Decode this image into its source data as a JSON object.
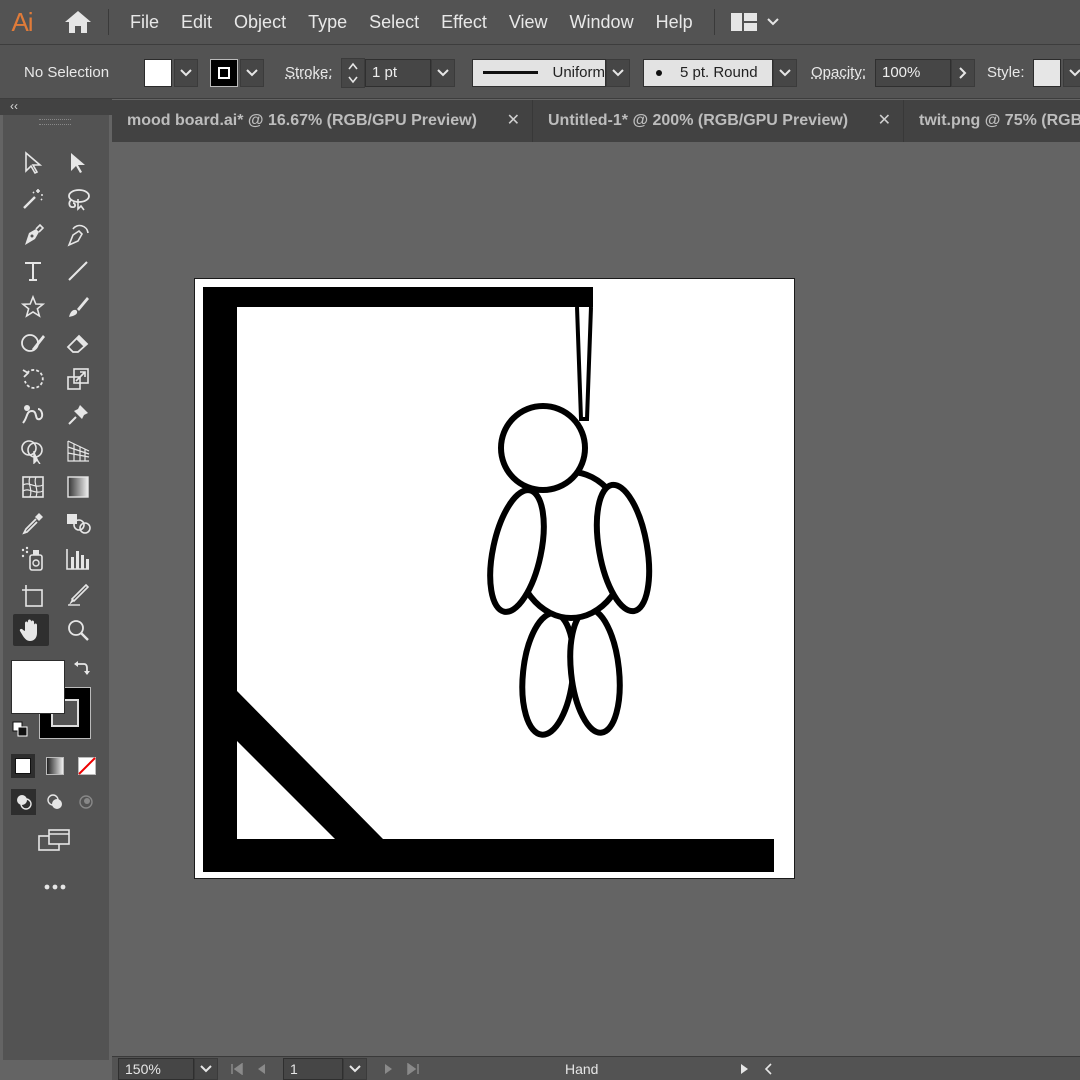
{
  "app": {
    "logo": "Ai"
  },
  "menu": [
    "File",
    "Edit",
    "Object",
    "Type",
    "Select",
    "Effect",
    "View",
    "Window",
    "Help"
  ],
  "control": {
    "selection": "No Selection",
    "stroke_label": "Stroke:",
    "stroke_weight": "1 pt",
    "stroke_profile": "Uniform",
    "brush": "5 pt. Round",
    "opacity_label": "Opacity:",
    "opacity_value": "100%",
    "style_label": "Style:"
  },
  "tabs": [
    {
      "label": "mood board.ai* @ 16.67% (RGB/GPU Preview)"
    },
    {
      "label": "Untitled-1* @ 200% (RGB/GPU Preview)"
    },
    {
      "label": "twit.png @ 75% (RGB"
    }
  ],
  "tools_collapse": "‹‹",
  "status": {
    "zoom": "150%",
    "artboard_number": "1",
    "current_tool": "Hand"
  },
  "colors": {
    "ui_bg": "#535353",
    "canvas_bg": "#646464",
    "accent_logo": "#e07b39"
  }
}
